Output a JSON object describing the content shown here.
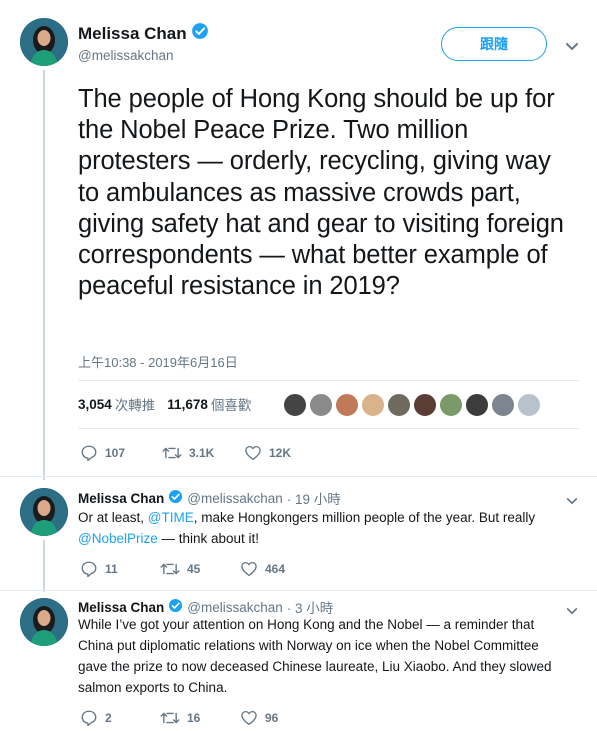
{
  "main_tweet": {
    "display_name": "Melissa Chan",
    "handle": "@melissakchan",
    "follow_label": "跟隨",
    "text": "The people of Hong Kong should be up for the Nobel Peace Prize. Two million protesters — orderly, recycling, giving way to ambulances as massive crowds part, giving safety hat and gear to visiting foreign correspondents — what better example of peaceful resistance in 2019?",
    "timestamp": "上午10:38 - 2019年6月16日",
    "retweets": "3,054",
    "retweets_label": "次轉推",
    "likes": "11,678",
    "likes_label": "個喜歡",
    "liker_colors": [
      "#444444",
      "#8a8a8a",
      "#c07a5a",
      "#d9b38c",
      "#6e6a5e",
      "#5a3d35",
      "#7a9a6a",
      "#3c3c3c",
      "#7d8590",
      "#b8c2cc"
    ],
    "reply_count": "107",
    "retweet_count": "3.1K",
    "like_count": "12K"
  },
  "replies": [
    {
      "display_name": "Melissa Chan",
      "handle": "@melissakchan",
      "time": "· 19 小時",
      "line1_pre": "Or at least, ",
      "mention1": "@TIME",
      "line1_post": ", make Hongkongers million people of the year. But really",
      "mention2": "@NobelPrize",
      "line2_post": " — think about it!",
      "reply_count": "11",
      "retweet_count": "45",
      "like_count": "464"
    },
    {
      "display_name": "Melissa Chan",
      "handle": "@melissakchan",
      "time": "· 3 小時",
      "text": "While I’ve got your attention on Hong Kong and the Nobel — a reminder that China put diplomatic relations with Norway on ice when the Nobel Committee gave the prize to now deceased Chinese laureate, Liu Xiaobo. And they slowed salmon exports to China.",
      "reply_count": "2",
      "retweet_count": "16",
      "like_count": "96"
    }
  ],
  "colors": {
    "accent": "#1da1f2",
    "text": "#14171a",
    "secondary": "#657786",
    "thread_line": "#ccd6dd"
  }
}
